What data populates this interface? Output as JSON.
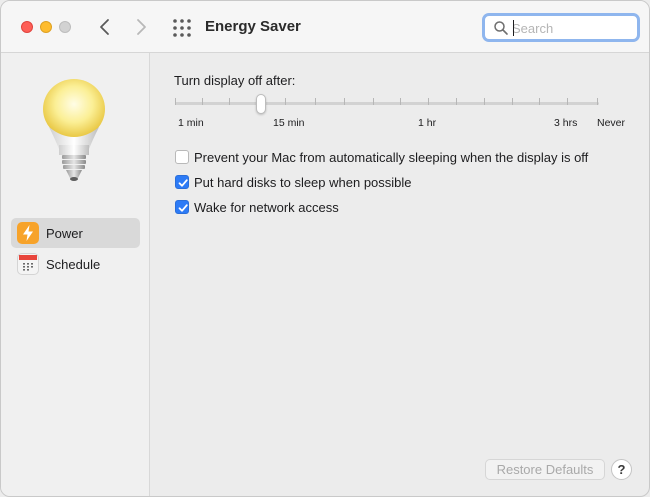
{
  "window": {
    "title": "Energy Saver"
  },
  "search": {
    "placeholder": "Search",
    "value": ""
  },
  "sidebar": {
    "items": [
      {
        "label": "Power",
        "icon": "lightning-bolt-icon",
        "selected": true
      },
      {
        "label": "Schedule",
        "icon": "calendar-icon",
        "selected": false
      }
    ]
  },
  "display_sleep": {
    "label": "Turn display off after:",
    "tick_labels": [
      "1 min",
      "15 min",
      "1 hr",
      "3 hrs",
      "Never"
    ],
    "selected_value": "15 min"
  },
  "options": [
    {
      "label": "Prevent your Mac from automatically sleeping when the display is off",
      "checked": false
    },
    {
      "label": "Put hard disks to sleep when possible",
      "checked": true
    },
    {
      "label": "Wake for network access",
      "checked": true
    }
  ],
  "buttons": {
    "restore_defaults": "Restore Defaults",
    "help": "?"
  },
  "colors": {
    "accent": "#2d7bf6",
    "close": "#fe5f57",
    "minimize": "#febc2e",
    "power_icon": "#f7a32a"
  }
}
